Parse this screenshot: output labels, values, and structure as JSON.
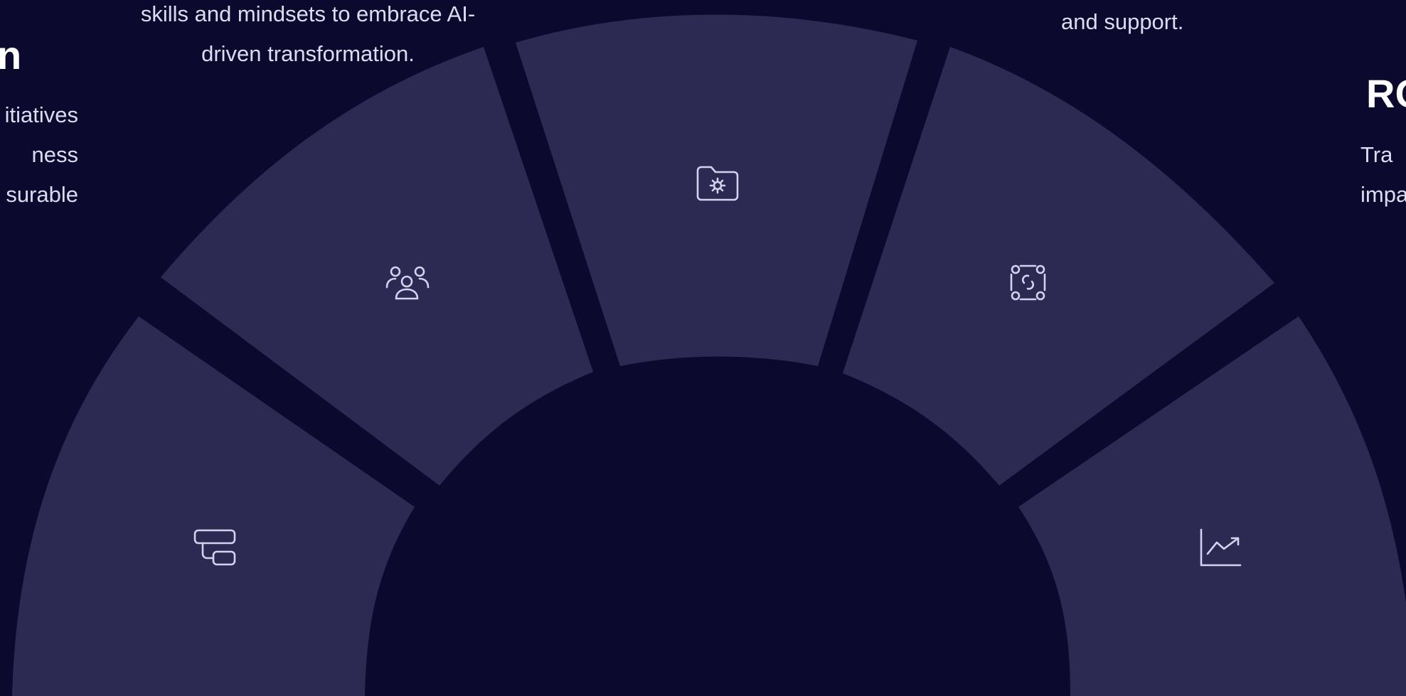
{
  "colors": {
    "background": "#0b0a2e",
    "segment": "#2c2a52",
    "icon": "#d4d2ef",
    "text": "#dcdcf0"
  },
  "segments": [
    {
      "id": "far-left",
      "icon": "workflow-icon"
    },
    {
      "id": "mid-left",
      "icon": "team-icon"
    },
    {
      "id": "center",
      "icon": "folder-gear-icon"
    },
    {
      "id": "mid-right",
      "icon": "connected-cycle-icon"
    },
    {
      "id": "far-right",
      "icon": "growth-chart-icon"
    }
  ],
  "texts": {
    "skills": {
      "lines": [
        "skills and mindsets to embrace AI-",
        "driven transformation."
      ]
    },
    "left_heading": "n",
    "left_lines": [
      "itiatives",
      "ness",
      "surable"
    ],
    "support": "and support.",
    "right_heading": "RO",
    "right_lines": [
      "Tra",
      "impa"
    ]
  }
}
